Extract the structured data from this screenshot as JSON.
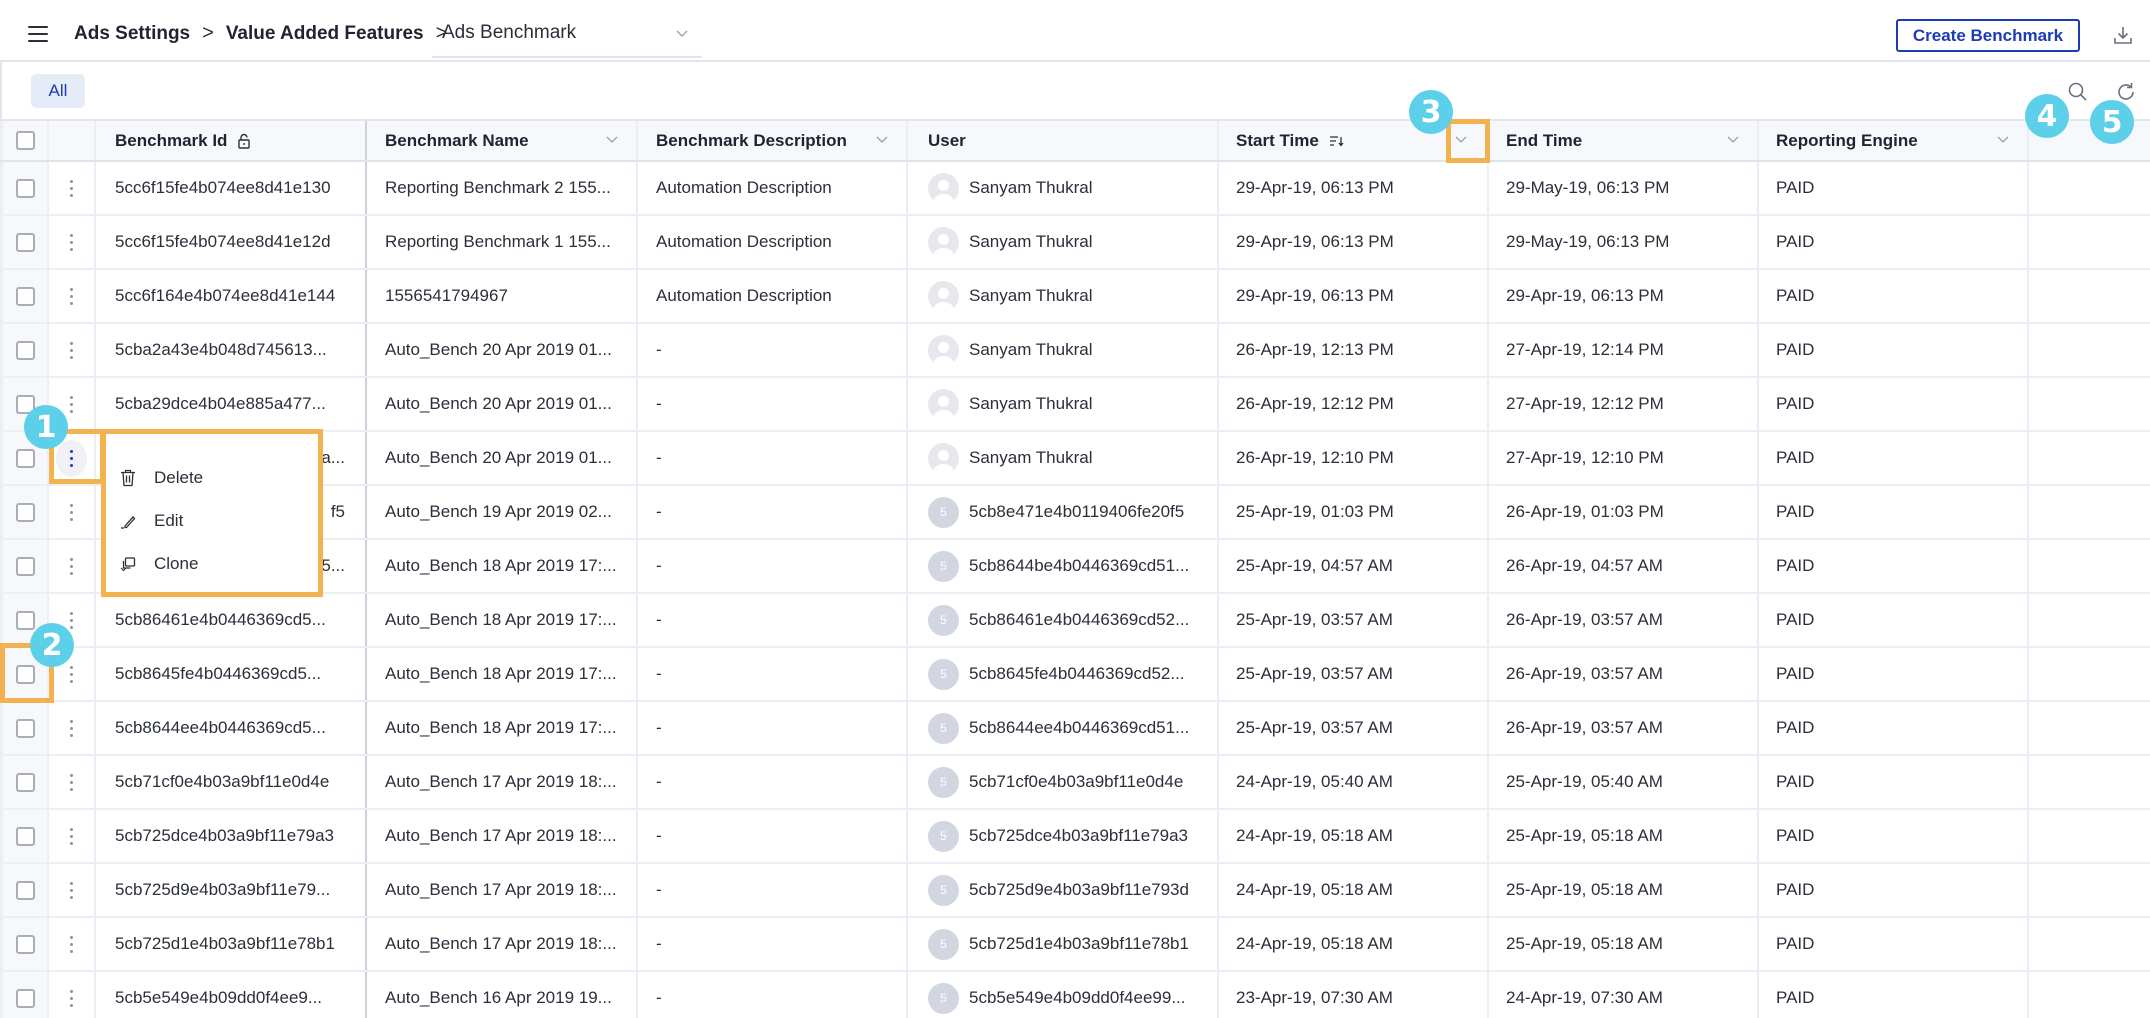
{
  "topbar": {
    "breadcrumbs": [
      "Ads Settings",
      "Value Added Features"
    ],
    "breadcrumb_separator": ">",
    "current_page_select": "Ads Benchmark",
    "create_button": "Create Benchmark",
    "icons": {
      "menu": "hamburger-icon",
      "download": "download-icon"
    }
  },
  "toolbar": {
    "filter_chip": "All",
    "icons": {
      "search": "search-icon",
      "refresh": "refresh-icon"
    }
  },
  "table": {
    "columns": {
      "id": "Benchmark Id",
      "name": "Benchmark Name",
      "description": "Benchmark Description",
      "user": "User",
      "start": "Start Time",
      "end": "End Time",
      "engine": "Reporting Engine"
    },
    "rows": [
      {
        "id": "5cc6f15fe4b074ee8d41e130",
        "name": "Reporting Benchmark 2 155...",
        "description": "Automation Description",
        "user": "Sanyam Thukral",
        "avatar": "person",
        "start": "29-Apr-19, 06:13 PM",
        "end": "29-May-19, 06:13 PM",
        "engine": "PAID"
      },
      {
        "id": "5cc6f15fe4b074ee8d41e12d",
        "name": "Reporting Benchmark 1 155...",
        "description": "Automation Description",
        "user": "Sanyam Thukral",
        "avatar": "person",
        "start": "29-Apr-19, 06:13 PM",
        "end": "29-May-19, 06:13 PM",
        "engine": "PAID"
      },
      {
        "id": "5cc6f164e4b074ee8d41e144",
        "name": "1556541794967",
        "description": "Automation Description",
        "user": "Sanyam Thukral",
        "avatar": "person",
        "start": "29-Apr-19, 06:13 PM",
        "end": "29-Apr-19, 06:13 PM",
        "engine": "PAID"
      },
      {
        "id": "5cba2a43e4b048d745613...",
        "name": "Auto_Bench 20 Apr 2019 01...",
        "description": "-",
        "user": "Sanyam Thukral",
        "avatar": "person",
        "start": "26-Apr-19, 12:13 PM",
        "end": "27-Apr-19, 12:14 PM",
        "engine": "PAID"
      },
      {
        "id": "5cba29dce4b04e885a477...",
        "name": "Auto_Bench 20 Apr 2019 01...",
        "description": "-",
        "user": "Sanyam Thukral",
        "avatar": "person",
        "start": "26-Apr-19, 12:12 PM",
        "end": "27-Apr-19, 12:12 PM",
        "engine": "PAID"
      },
      {
        "id": "a...",
        "name": "Auto_Bench 20 Apr 2019 01...",
        "description": "-",
        "user": "Sanyam Thukral",
        "avatar": "person",
        "start": "26-Apr-19, 12:10 PM",
        "end": "27-Apr-19, 12:10 PM",
        "engine": "PAID"
      },
      {
        "id": "f5",
        "name": "Auto_Bench 19 Apr 2019 02...",
        "description": "-",
        "user": "5cb8e471e4b0119406fe20f5",
        "avatar": "5",
        "start": "25-Apr-19, 01:03 PM",
        "end": "26-Apr-19, 01:03 PM",
        "engine": "PAID"
      },
      {
        "id": "5...",
        "name": "Auto_Bench 18 Apr 2019 17:...",
        "description": "-",
        "user": "5cb8644be4b0446369cd51...",
        "avatar": "5",
        "start": "25-Apr-19, 04:57 AM",
        "end": "26-Apr-19, 04:57 AM",
        "engine": "PAID"
      },
      {
        "id": "5cb86461e4b0446369cd5...",
        "name": "Auto_Bench 18 Apr 2019 17:...",
        "description": "-",
        "user": "5cb86461e4b0446369cd52...",
        "avatar": "5",
        "start": "25-Apr-19, 03:57 AM",
        "end": "26-Apr-19, 03:57 AM",
        "engine": "PAID"
      },
      {
        "id": "5cb8645fe4b0446369cd5...",
        "name": "Auto_Bench 18 Apr 2019 17:...",
        "description": "-",
        "user": "5cb8645fe4b0446369cd52...",
        "avatar": "5",
        "start": "25-Apr-19, 03:57 AM",
        "end": "26-Apr-19, 03:57 AM",
        "engine": "PAID"
      },
      {
        "id": "5cb8644ee4b0446369cd5...",
        "name": "Auto_Bench 18 Apr 2019 17:...",
        "description": "-",
        "user": "5cb8644ee4b0446369cd51...",
        "avatar": "5",
        "start": "25-Apr-19, 03:57 AM",
        "end": "26-Apr-19, 03:57 AM",
        "engine": "PAID"
      },
      {
        "id": "5cb71cf0e4b03a9bf11e0d4e",
        "name": "Auto_Bench 17 Apr 2019 18:...",
        "description": "-",
        "user": "5cb71cf0e4b03a9bf11e0d4e",
        "avatar": "5",
        "start": "24-Apr-19, 05:40 AM",
        "end": "25-Apr-19, 05:40 AM",
        "engine": "PAID"
      },
      {
        "id": "5cb725dce4b03a9bf11e79a3",
        "name": "Auto_Bench 17 Apr 2019 18:...",
        "description": "-",
        "user": "5cb725dce4b03a9bf11e79a3",
        "avatar": "5",
        "start": "24-Apr-19, 05:18 AM",
        "end": "25-Apr-19, 05:18 AM",
        "engine": "PAID"
      },
      {
        "id": "5cb725d9e4b03a9bf11e79...",
        "name": "Auto_Bench 17 Apr 2019 18:...",
        "description": "-",
        "user": "5cb725d9e4b03a9bf11e793d",
        "avatar": "5",
        "start": "24-Apr-19, 05:18 AM",
        "end": "25-Apr-19, 05:18 AM",
        "engine": "PAID"
      },
      {
        "id": "5cb725d1e4b03a9bf11e78b1",
        "name": "Auto_Bench 17 Apr 2019 18:...",
        "description": "-",
        "user": "5cb725d1e4b03a9bf11e78b1",
        "avatar": "5",
        "start": "24-Apr-19, 05:18 AM",
        "end": "25-Apr-19, 05:18 AM",
        "engine": "PAID"
      },
      {
        "id": "5cb5e549e4b09dd0f4ee9...",
        "name": "Auto_Bench 16 Apr 2019 19...",
        "description": "-",
        "user": "5cb5e549e4b09dd0f4ee99...",
        "avatar": "5",
        "start": "23-Apr-19, 07:30 AM",
        "end": "24-Apr-19, 07:30 AM",
        "engine": "PAID"
      }
    ]
  },
  "context_menu": {
    "items": [
      {
        "label": "Delete",
        "icon": "trash-icon"
      },
      {
        "label": "Edit",
        "icon": "pencil-icon"
      },
      {
        "label": "Clone",
        "icon": "clone-icon"
      }
    ]
  },
  "annotations": {
    "badges": [
      "1",
      "2",
      "3",
      "4",
      "5"
    ],
    "badge_color": "#5ccfe9",
    "highlight_color": "#f2b24f"
  },
  "colors": {
    "accent": "#1d3bb5",
    "header_bg": "#f7f8fb",
    "chip_bg": "#e6ebf8"
  }
}
